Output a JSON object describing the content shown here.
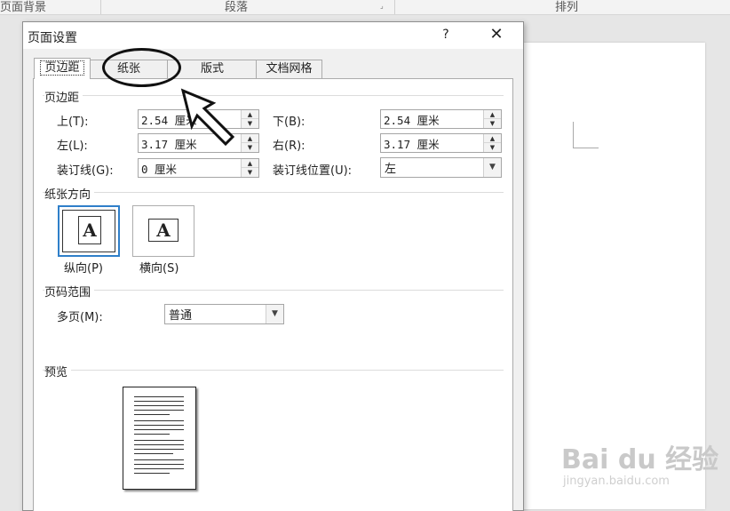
{
  "ribbon": {
    "group1": "页面背景",
    "group2": "段落",
    "group3": "排列"
  },
  "dialog": {
    "title": "页面设置",
    "help": "?",
    "close": "✕",
    "tabs": [
      "页边距",
      "纸张",
      "版式",
      "文档网格"
    ],
    "margins": {
      "section": "页边距",
      "top_label": "上(T):",
      "top_value": "2.54 厘米",
      "bottom_label": "下(B):",
      "bottom_value": "2.54 厘米",
      "left_label": "左(L):",
      "left_value": "3.17 厘米",
      "right_label": "右(R):",
      "right_value": "3.17 厘米",
      "gutter_label": "装订线(G):",
      "gutter_value": "0 厘米",
      "gutter_pos_label": "装订线位置(U):",
      "gutter_pos_value": "左"
    },
    "orientation": {
      "section": "纸张方向",
      "portrait": "纵向(P)",
      "landscape": "横向(S)",
      "glyph": "A"
    },
    "pages": {
      "section": "页码范围",
      "multiple_label": "多页(M):",
      "multiple_value": "普通"
    },
    "preview": {
      "section": "预览"
    }
  },
  "watermark": {
    "text": "Bai du 经验",
    "sub": "jingyan.baidu.com"
  },
  "colors": {
    "selection_border": "#2f7fc9",
    "dialog_bg": "#f0f0f0"
  }
}
